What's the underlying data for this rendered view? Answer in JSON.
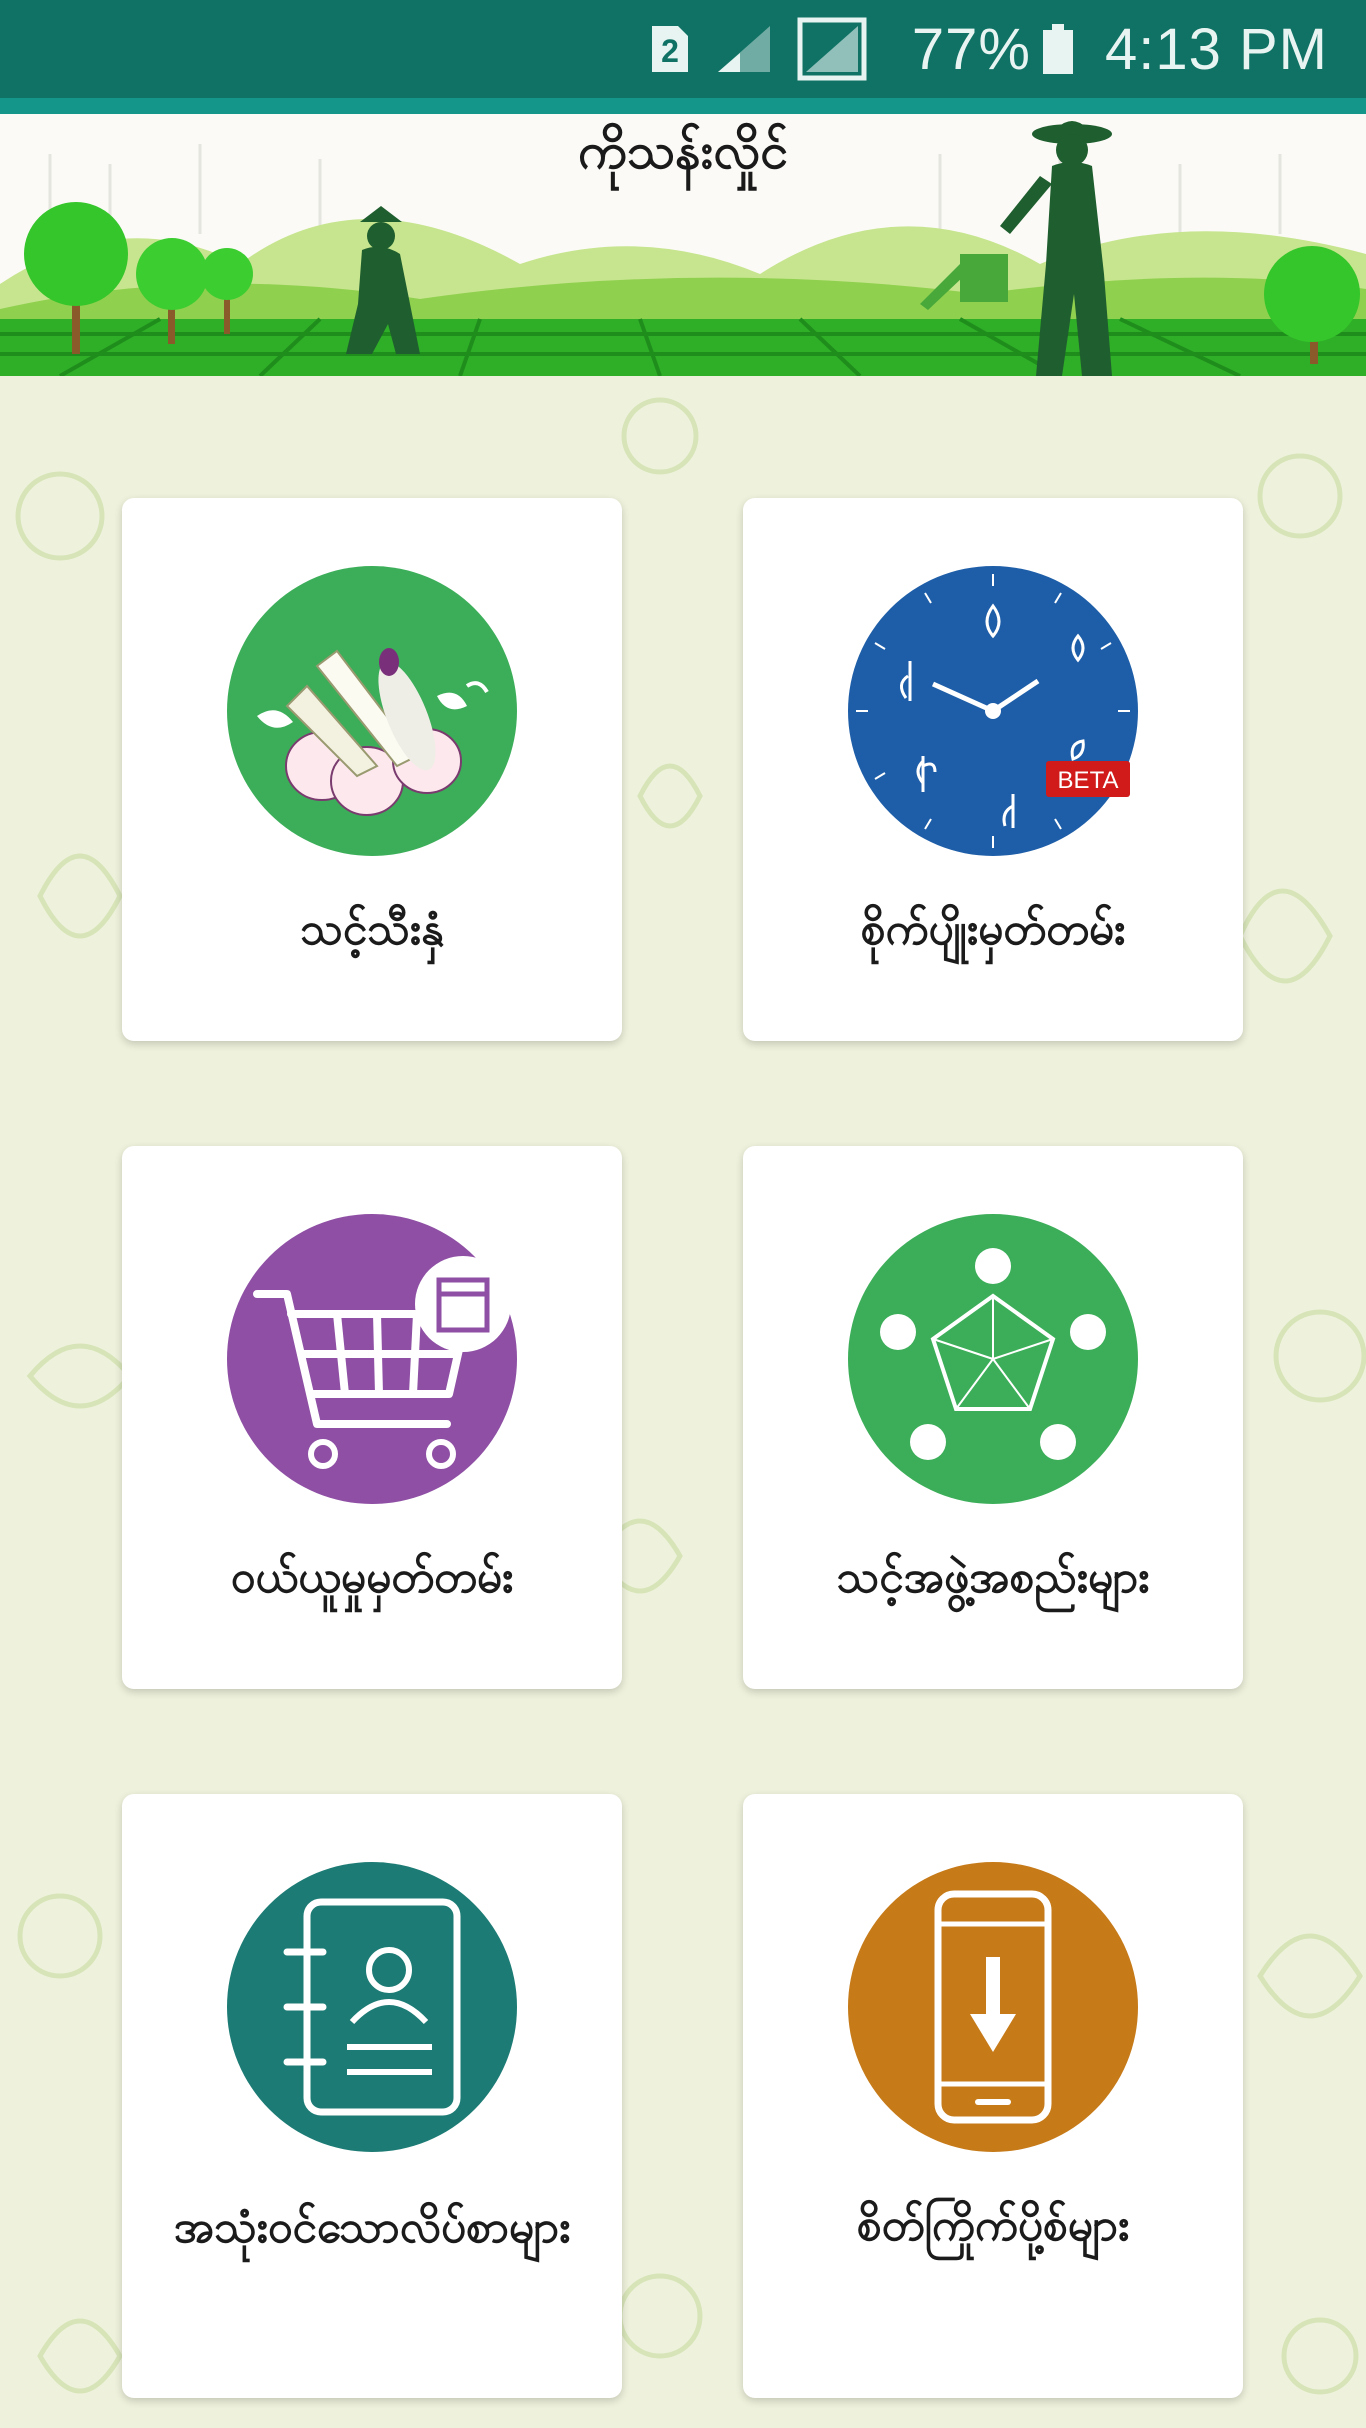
{
  "status_bar": {
    "sim_slot": "2",
    "battery_percent": "77%",
    "time": "4:13 PM"
  },
  "header": {
    "title": "ကိုသန်းလှိုင်"
  },
  "menu": [
    {
      "id": "vegetables",
      "label": "သင့်သီးနှံ",
      "icon": "vegetables-icon",
      "color": "#3cae59"
    },
    {
      "id": "calendar",
      "label": "စိုက်ပျိုးမှတ်တမ်း",
      "icon": "crop-clock-icon",
      "color": "#1e5ea8",
      "badge": "BETA"
    },
    {
      "id": "purchase",
      "label": "ဝယ်ယူမှုမှတ်တမ်း",
      "icon": "shopping-cart-icon",
      "color": "#8e4fa4"
    },
    {
      "id": "groups",
      "label": "သင့်အဖွဲ့အစည်းများ",
      "icon": "group-meeting-icon",
      "color": "#3cae59"
    },
    {
      "id": "contacts",
      "label": "အသုံးဝင်သောလိပ်စာများ",
      "icon": "contact-book-icon",
      "color": "#1c7b74"
    },
    {
      "id": "downloads",
      "label": "စိတ်ကြိုက်ပို့စ်များ",
      "icon": "phone-download-icon",
      "color": "#c67a18"
    }
  ]
}
